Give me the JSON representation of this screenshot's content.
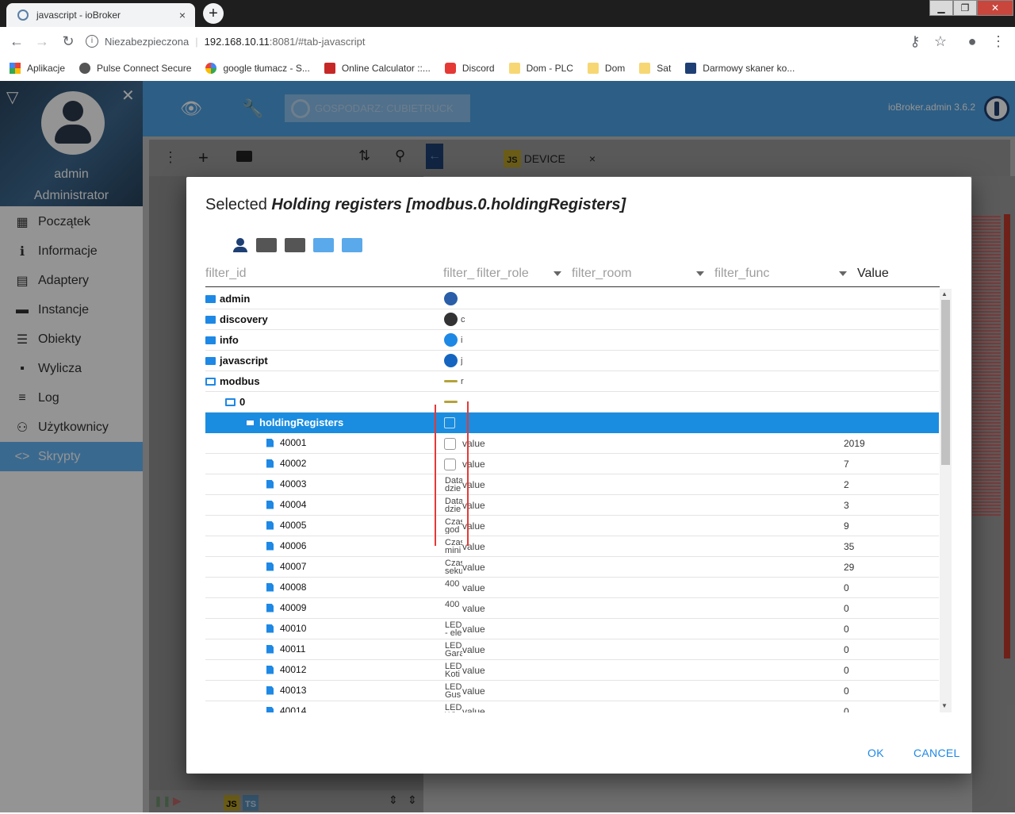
{
  "browser": {
    "tab_title": "javascript - ioBroker",
    "tab_close": "×",
    "new_tab": "+",
    "insecure_label": "Niezabezpieczona",
    "url_host": "192.168.10.11",
    "url_path": ":8081/#tab-javascript",
    "bookmarks": [
      {
        "label": "Aplikacje",
        "icon": "apps-grid-icon"
      },
      {
        "label": "Pulse Connect Secure",
        "icon": "pulse-icon"
      },
      {
        "label": "google tłumacz - S...",
        "icon": "google-icon"
      },
      {
        "label": "Online Calculator ::...",
        "icon": "calculator-icon"
      },
      {
        "label": "Discord",
        "icon": "discord-icon"
      },
      {
        "label": "Dom - PLC",
        "icon": "folder-icon"
      },
      {
        "label": "Dom",
        "icon": "folder-icon"
      },
      {
        "label": "Sat",
        "icon": "folder-icon"
      },
      {
        "label": "Darmowy skaner ko...",
        "icon": "scanner-icon"
      }
    ]
  },
  "app": {
    "user_name": "admin",
    "user_role": "Administrator",
    "host_label": "GOSPODARZ: CUBIETRUCK",
    "version": "ioBroker.admin 3.6.2",
    "menu": [
      {
        "label": "Początek",
        "icon": "grid-icon",
        "glyph": "▦"
      },
      {
        "label": "Informacje",
        "icon": "info-icon",
        "glyph": "ℹ"
      },
      {
        "label": "Adaptery",
        "icon": "store-icon",
        "glyph": "▤"
      },
      {
        "label": "Instancje",
        "icon": "instances-icon",
        "glyph": "▬"
      },
      {
        "label": "Obiekty",
        "icon": "list-icon",
        "glyph": "☰"
      },
      {
        "label": "Wylicza",
        "icon": "enum-icon",
        "glyph": "▪"
      },
      {
        "label": "Log",
        "icon": "log-icon",
        "glyph": "≡"
      },
      {
        "label": "Użytkownicy",
        "icon": "user-icon",
        "glyph": "⚇"
      },
      {
        "label": "Skrypty",
        "icon": "code-icon",
        "glyph": "<>"
      }
    ],
    "editor_tab": "DEVICE",
    "editor_tab_close": "×",
    "js_badge": "JS"
  },
  "dialog": {
    "title_prefix": "Selected ",
    "title_bold": "Holding registers [modbus.0.holdingRegisters]",
    "headers": {
      "id": "filter_id",
      "name": "filter_",
      "role": "filter_role",
      "room": "filter_room",
      "func": "filter_func",
      "value": "Value"
    },
    "rows": [
      {
        "name": "admin",
        "indent": 0,
        "type": "folder",
        "col2": "",
        "role": "",
        "value": ""
      },
      {
        "name": "discovery",
        "indent": 0,
        "type": "folder",
        "col2": "c",
        "role": "",
        "value": ""
      },
      {
        "name": "info",
        "indent": 0,
        "type": "folder",
        "col2": "i",
        "role": "",
        "value": ""
      },
      {
        "name": "javascript",
        "indent": 0,
        "type": "folder",
        "col2": "j",
        "role": "",
        "value": ""
      },
      {
        "name": "modbus",
        "indent": 0,
        "type": "folder-open",
        "col2": "r",
        "role": "",
        "value": ""
      },
      {
        "name": "0",
        "indent": 1,
        "type": "folder-open",
        "col2": "",
        "role": "",
        "value": ""
      },
      {
        "name": "holdingRegisters",
        "indent": 2,
        "type": "folder-open",
        "col2": "",
        "role": "",
        "value": "",
        "selected": true
      },
      {
        "name": "40001",
        "indent": 3,
        "type": "state",
        "col2": "",
        "role": "value",
        "value": "2019"
      },
      {
        "name": "40002",
        "indent": 3,
        "type": "state",
        "col2": "",
        "role": "value",
        "value": "7"
      },
      {
        "name": "40003",
        "indent": 3,
        "type": "state",
        "col2": "Data dzie",
        "role": "value",
        "value": "2"
      },
      {
        "name": "40004",
        "indent": 3,
        "type": "state",
        "col2": "Data dzie",
        "role": "value",
        "value": "3"
      },
      {
        "name": "40005",
        "indent": 3,
        "type": "state",
        "col2": "Czas god",
        "role": "value",
        "value": "9"
      },
      {
        "name": "40006",
        "indent": 3,
        "type": "state",
        "col2": "Czas mini",
        "role": "value",
        "value": "35"
      },
      {
        "name": "40007",
        "indent": 3,
        "type": "state",
        "col2": "Czas seku",
        "role": "value",
        "value": "29"
      },
      {
        "name": "40008",
        "indent": 3,
        "type": "state",
        "col2": "400",
        "role": "value",
        "value": "0"
      },
      {
        "name": "40009",
        "indent": 3,
        "type": "state",
        "col2": "400",
        "role": "value",
        "value": "0"
      },
      {
        "name": "40010",
        "indent": 3,
        "type": "state",
        "col2": "LED - ele",
        "role": "value",
        "value": "0"
      },
      {
        "name": "40011",
        "indent": 3,
        "type": "state",
        "col2": "LED Gara",
        "role": "value",
        "value": "0"
      },
      {
        "name": "40012",
        "indent": 3,
        "type": "state",
        "col2": "LED Koti",
        "role": "value",
        "value": "0"
      },
      {
        "name": "40013",
        "indent": 3,
        "type": "state",
        "col2": "LED Gus",
        "role": "value",
        "value": "0"
      },
      {
        "name": "40014",
        "indent": 3,
        "type": "state",
        "col2": "LED Wia",
        "role": "value",
        "value": "0"
      }
    ],
    "ok_label": "OK",
    "cancel_label": "CANCEL"
  }
}
